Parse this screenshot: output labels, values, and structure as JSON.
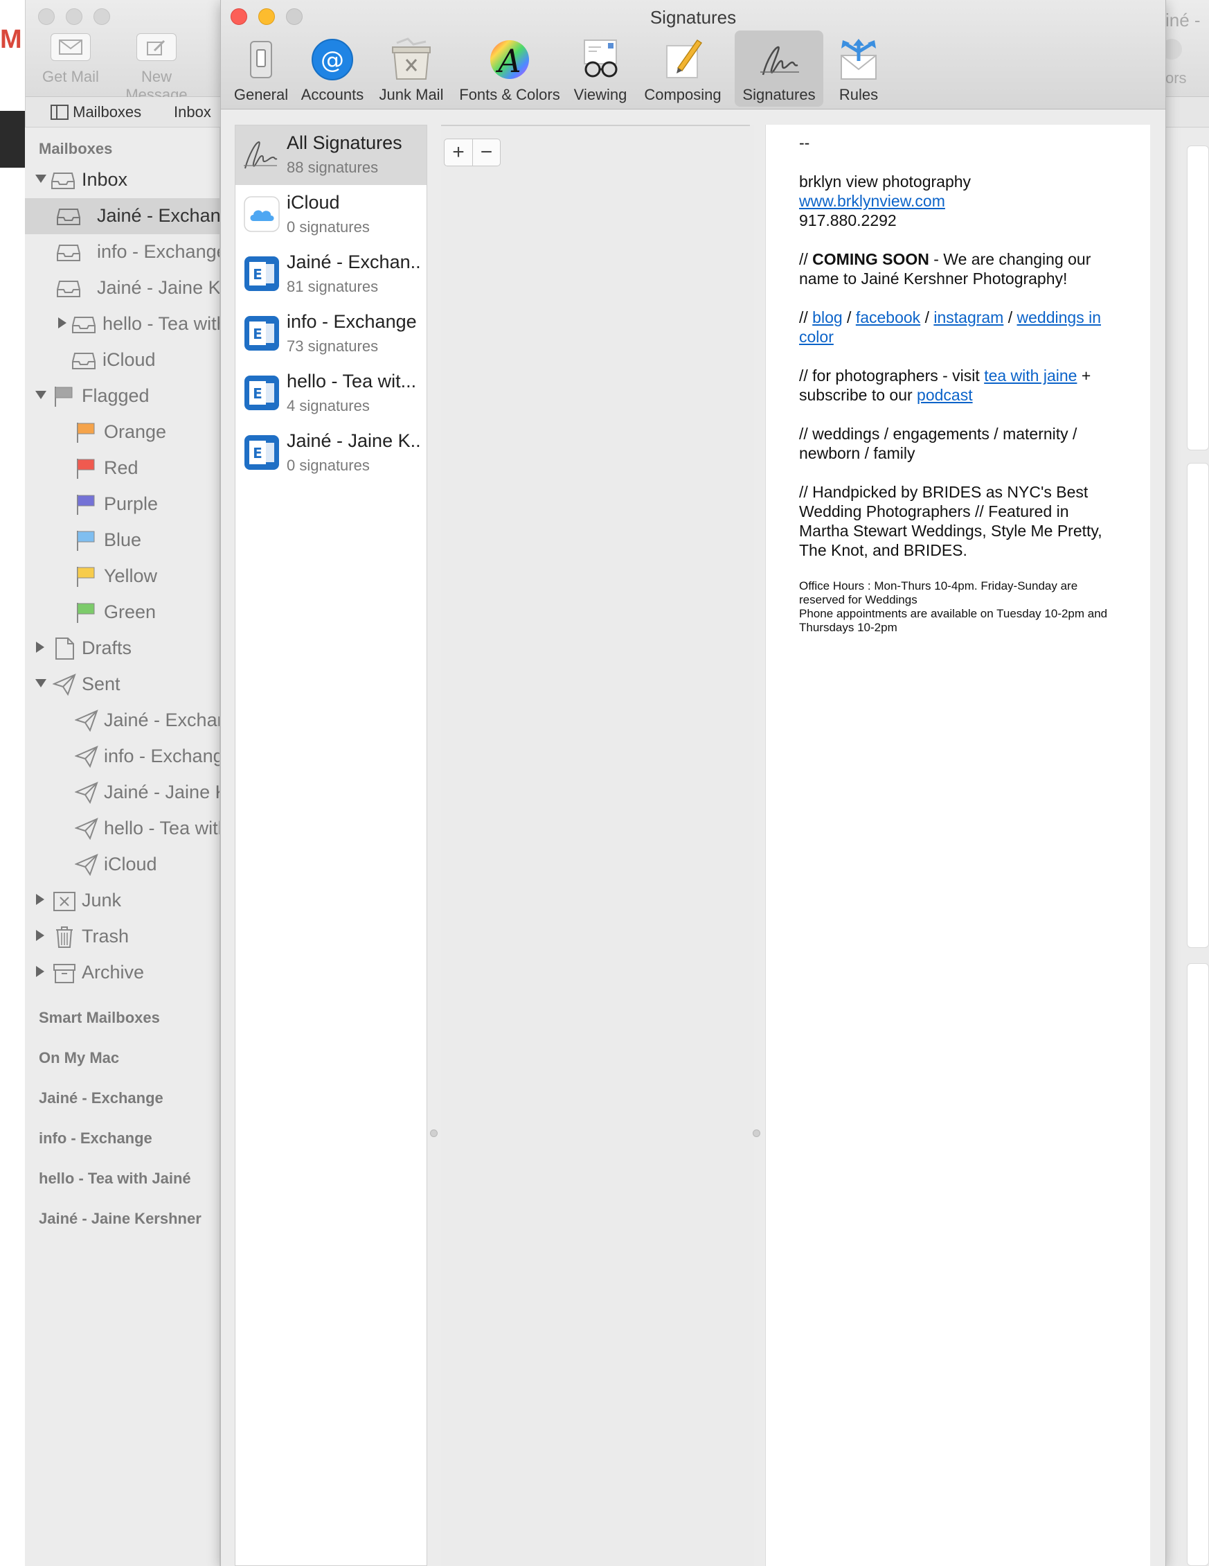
{
  "main_window": {
    "toolbar": {
      "get_mail": "Get Mail",
      "new_message": "New Message",
      "right_partial": "ors"
    },
    "title_partial": "iné -",
    "tabs": {
      "mailboxes": "Mailboxes",
      "inbox": "Inbox"
    }
  },
  "sidebar": {
    "header": "Mailboxes",
    "inbox": "Inbox",
    "inbox_items": [
      "Jainé - Exchange",
      "info - Exchange",
      "Jainé - Jaine Kershner",
      "hello - Tea with Jainé",
      "iCloud"
    ],
    "flagged": "Flagged",
    "flags": [
      {
        "label": "Orange",
        "color": "#f5a34a"
      },
      {
        "label": "Red",
        "color": "#f05a4f"
      },
      {
        "label": "Purple",
        "color": "#7472d6"
      },
      {
        "label": "Blue",
        "color": "#7fbef0"
      },
      {
        "label": "Yellow",
        "color": "#f7cc4c"
      },
      {
        "label": "Green",
        "color": "#7ccb6a"
      }
    ],
    "drafts": "Drafts",
    "sent": "Sent",
    "sent_items": [
      "Jainé - Exchange",
      "info - Exchange",
      "Jainé - Jaine Kershner",
      "hello - Tea with Jainé",
      "iCloud"
    ],
    "junk": "Junk",
    "trash": "Trash",
    "archive": "Archive",
    "section_headers": [
      "Smart Mailboxes",
      "On My Mac",
      "Jainé - Exchange",
      "info - Exchange",
      "hello - Tea with Jainé",
      "Jainé - Jaine Kershner"
    ]
  },
  "prefs": {
    "title": "Signatures",
    "toolbar": [
      {
        "label": "General",
        "icon": "general-switch-icon"
      },
      {
        "label": "Accounts",
        "icon": "at-sign-icon"
      },
      {
        "label": "Junk Mail",
        "icon": "junk-bin-icon"
      },
      {
        "label": "Fonts & Colors",
        "icon": "fonts-colors-icon"
      },
      {
        "label": "Viewing",
        "icon": "viewing-glasses-icon"
      },
      {
        "label": "Composing",
        "icon": "composing-pencil-icon"
      },
      {
        "label": "Signatures",
        "icon": "signature-icon"
      },
      {
        "label": "Rules",
        "icon": "rules-envelope-icon"
      }
    ],
    "accounts": [
      {
        "name": "All Signatures",
        "count": "88 signatures"
      },
      {
        "name": "iCloud",
        "count": "0 signatures"
      },
      {
        "name": "Jainé - Exchan...",
        "count": "81 signatures"
      },
      {
        "name": "info - Exchange",
        "count": "73 signatures"
      },
      {
        "name": "hello - Tea wit...",
        "count": "4 signatures"
      },
      {
        "name": "Jainé - Jaine K...",
        "count": "0 signatures"
      }
    ],
    "add_label": "+",
    "remove_label": "−"
  },
  "signature": {
    "dashes": "--",
    "line1": "brklyn view photography",
    "website": "www.brklynview.com",
    "phone": "917.880.2292",
    "coming_prefix": "// ",
    "coming_bold": "COMING SOON",
    "coming_rest": " - We are changing our name to Jainé Kershner Photography!",
    "links_prefix": "// ",
    "link_blog": "blog",
    "sep": " / ",
    "link_facebook": "facebook",
    "link_instagram": "instagram",
    "link_weddings": "weddings in color",
    "photog_prefix": "// for photographers - visit ",
    "link_tea": "tea with jaine",
    "photog_mid": " + subscribe to our ",
    "link_podcast": "podcast",
    "services": "// weddings / engagements / maternity / newborn / family",
    "brides": "// Handpicked by BRIDES as NYC's Best Wedding Photographers // Featured in Martha Stewart Weddings, Style Me Pretty, The Knot, and BRIDES.",
    "office_hours": "Office Hours : Mon-Thurs 10-4pm. Friday-Sunday are reserved for Weddings",
    "phone_appts": "Phone appointments are available on Tuesday 10-2pm and Thursdays 10-2pm"
  }
}
